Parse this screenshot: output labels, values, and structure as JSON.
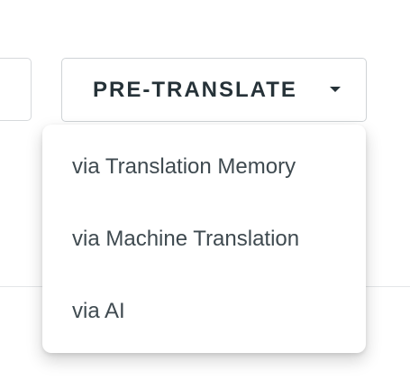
{
  "toolbar": {
    "pretranslate_label": "PRE-TRANSLATE",
    "caret_icon": "caret-down-icon"
  },
  "dropdown": {
    "items": [
      {
        "label": "via Translation Memory"
      },
      {
        "label": "via Machine Translation"
      },
      {
        "label": "via AI"
      }
    ]
  },
  "colors": {
    "text_primary": "#263238",
    "menu_text": "#3f4a50",
    "border": "#cfd3d6"
  }
}
